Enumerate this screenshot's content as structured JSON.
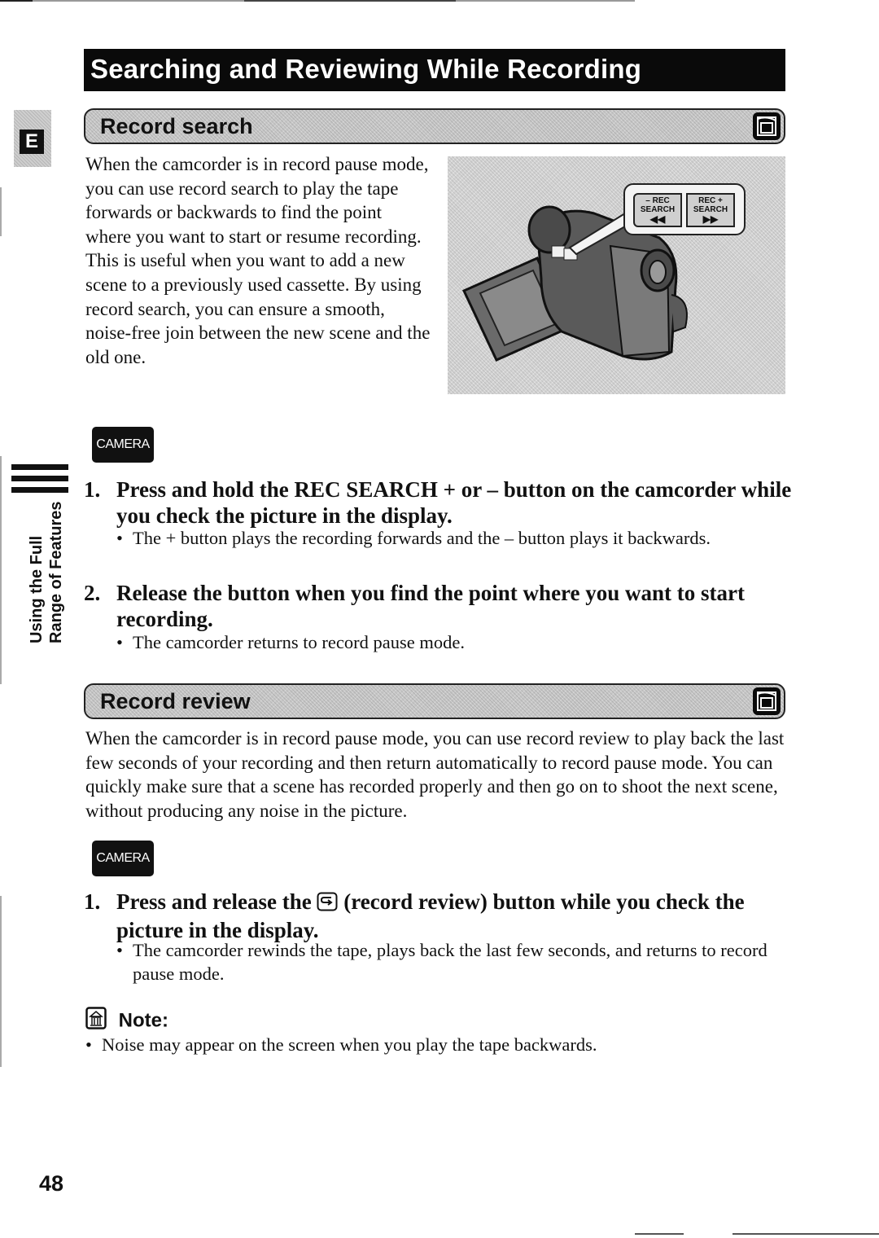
{
  "page": {
    "title": "Searching and Reviewing While Recording",
    "language_badge": "E",
    "side_tab": {
      "line1": "Using the Full",
      "line2": "Range of Features"
    },
    "page_number": "48"
  },
  "record_search": {
    "heading": "Record search",
    "mode_icon": "tape-mode-icon",
    "intro": "When the camcorder is in record pause mode, you can use record search to play the tape forwards or backwards to find the point where you want to start or resume recording. This is useful when you want to add a new scene to a previously used cassette. By using record search, you can ensure a smooth, noise-free join between the new scene and the old one.",
    "illustration": {
      "description": "camcorder-illustration",
      "buttons": [
        {
          "line1": "–  REC",
          "line2": "SEARCH",
          "symbol": "◀◀"
        },
        {
          "line1": "REC +",
          "line2": "SEARCH",
          "symbol": "▶▶"
        }
      ]
    },
    "mode_badge": "CAMERA",
    "steps": [
      {
        "number": "1.",
        "text": "Press and hold the REC SEARCH + or – button on the camcorder while you check the picture in the display.",
        "bullets": [
          "The + button plays the recording forwards and the – button plays it backwards."
        ]
      },
      {
        "number": "2.",
        "text": "Release the button when you find the point where you want to start recording.",
        "bullets": [
          "The camcorder returns to record pause mode."
        ]
      }
    ]
  },
  "record_review": {
    "heading": "Record review",
    "mode_icon": "tape-mode-icon",
    "intro": "When the camcorder is in record pause mode, you can use record review to play back the last few seconds of your recording and then return automatically to record pause mode. You can quickly make sure that a scene has recorded properly and then go on to shoot the next scene, without producing any noise in the picture.",
    "mode_badge": "CAMERA",
    "steps": [
      {
        "number": "1.",
        "text_before_icon": "Press and release the",
        "icon": "record-review-icon",
        "text_after_icon": "(record review) button while you check the picture in the display.",
        "bullets": [
          "The camcorder rewinds the tape, plays back the last few seconds, and returns to record pause mode."
        ]
      }
    ]
  },
  "note": {
    "heading": "Note:",
    "items": [
      "Noise may appear on the screen when you play the tape backwards."
    ]
  },
  "bullet_glyph": "•"
}
